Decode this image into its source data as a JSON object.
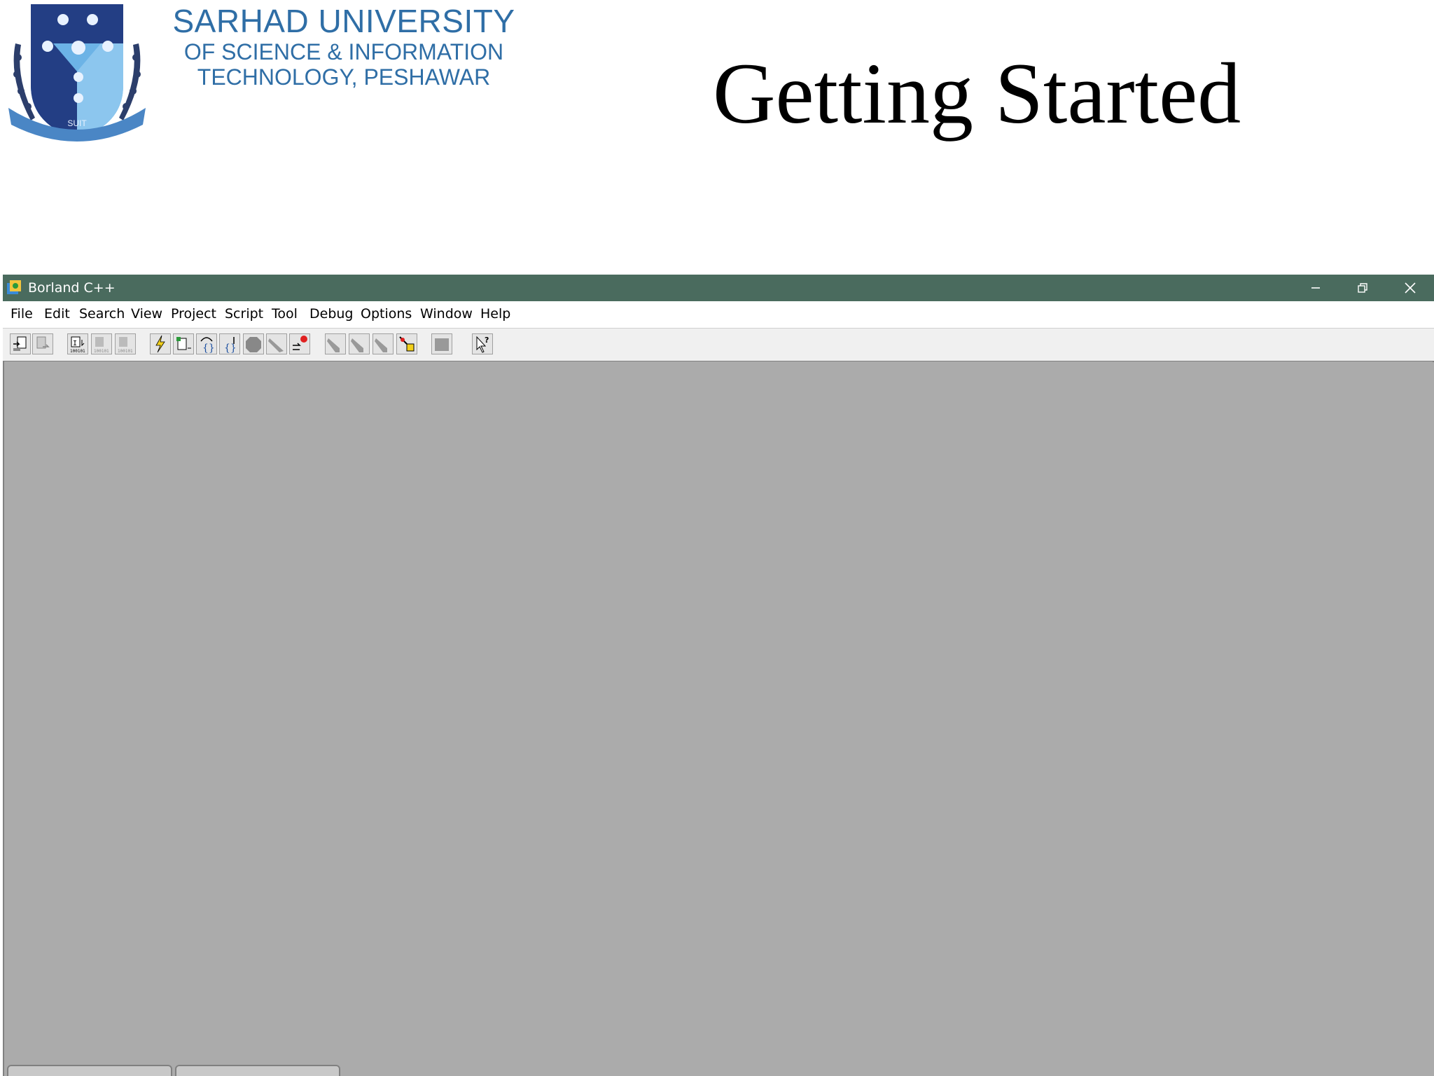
{
  "slide": {
    "university_line1": "SARHAD UNIVERSITY",
    "university_line2": "OF SCIENCE & INFORMATION",
    "university_line3": "TECHNOLOGY, PESHAWAR",
    "title": "Getting Started"
  },
  "window": {
    "title": "Borland C++",
    "controls": [
      "minimize-icon",
      "restore-icon",
      "close-icon"
    ]
  },
  "menu": {
    "items": [
      "File",
      "Edit",
      "Search",
      "View",
      "Project",
      "Script",
      "Tool",
      "Debug",
      "Options",
      "Window",
      "Help"
    ]
  },
  "toolbar": {
    "icons": [
      "open-project-icon",
      "close-project-icon",
      "compile-icon",
      "make-icon",
      "build-icon",
      "run-icon",
      "debug-icon",
      "step-over-icon",
      "trace-into-icon",
      "stop-icon",
      "toggle-breakpoint-icon",
      "add-watch-icon",
      "tool-icon",
      "tool-icon",
      "tool-icon",
      "browse-icon",
      "folder-icon",
      "help-pointer-icon"
    ]
  },
  "colors": {
    "titlebar": "#4a6b5e",
    "workspace": "#ababab",
    "university_text": "#2f6ea6"
  }
}
